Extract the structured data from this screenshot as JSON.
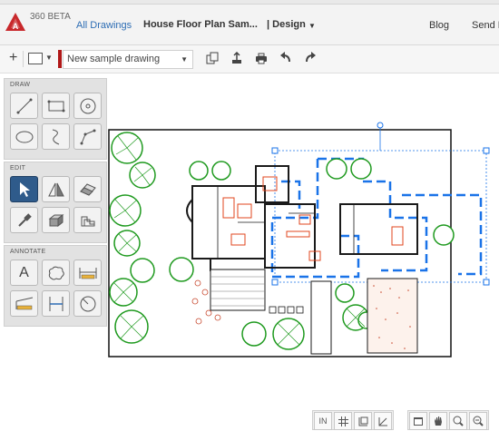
{
  "header": {
    "logo_icon": "autocad-logo-icon",
    "brand_colors": {
      "logo_red": "#c8282b",
      "link_blue": "#2d6db4"
    },
    "product_label": "360 BETA",
    "all_drawings": "All Drawings",
    "drawing_title": "House Floor Plan Sam...",
    "mode": "| Design",
    "blog": "Blog",
    "send": "Send F"
  },
  "toolbar": {
    "add_icon": "plus-icon",
    "add_label": "+",
    "layer_icon": "layer-icon",
    "layer_color": "#b01818",
    "layer_select_value": "New sample drawing",
    "icons": [
      "copy-icon",
      "export-icon",
      "print-icon",
      "undo-icon",
      "redo-icon"
    ]
  },
  "panels": {
    "draw": {
      "label": "DRAW",
      "tools": [
        "line-tool",
        "rectangle-tool",
        "circle-tool",
        "ellipse-tool",
        "freehand-tool",
        "polyline-tool"
      ]
    },
    "edit": {
      "label": "EDIT",
      "tools": [
        "select-tool",
        "mirror-tool",
        "eraser-tool",
        "eyedropper-tool",
        "3d-box-tool",
        "offset-tool"
      ]
    },
    "annotate": {
      "label": "ANNOTATE",
      "text_tool_label": "A",
      "tools": [
        "text-tool",
        "cloud-markup-tool",
        "linear-dimension-tool",
        "aligned-dimension-tool",
        "vertical-dimension-tool",
        "radius-tool"
      ]
    }
  },
  "status_bar": {
    "snap_in_label": "IN",
    "icons": [
      "grid-icon",
      "ortho-icon",
      "polar-icon",
      "layout-icon",
      "pan-icon",
      "zoom-window-icon",
      "zoom-extents-icon"
    ]
  },
  "drawing": {
    "tree_color": "#1f9a1f",
    "wall_color": "#1a1a1a",
    "furniture_color": "#e0461c",
    "selection_color": "#1a73e8"
  }
}
